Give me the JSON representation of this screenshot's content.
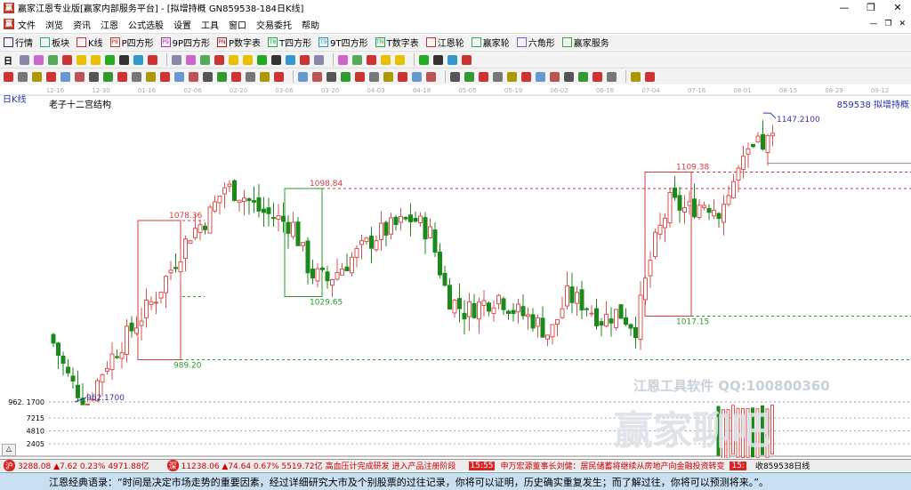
{
  "window": {
    "title": "赢家江恩专业版[赢家内部服务平台] - [拟增持概  GN859538-184日K线]",
    "min": "—",
    "max": "❐",
    "close": "✕"
  },
  "menu": [
    "文件",
    "浏览",
    "资讯",
    "江恩",
    "公式选股",
    "设置",
    "工具",
    "窗口",
    "交易委托",
    "帮助"
  ],
  "menu_right": [
    "—",
    "❐",
    "✕"
  ],
  "toolbar1": [
    {
      "icon": "grid-icon",
      "label": "行情"
    },
    {
      "icon": "blocks-icon",
      "label": "板块"
    },
    {
      "icon": "kline-icon",
      "label": "K线"
    },
    {
      "icon": "P8",
      "label": "P四方形"
    },
    {
      "icon": "P9",
      "label": "9P四方形"
    },
    {
      "icon": "PN",
      "label": "P数字表"
    },
    {
      "icon": "T8",
      "label": "T四方形"
    },
    {
      "icon": "T9",
      "label": "9T四方形"
    },
    {
      "icon": "TN",
      "label": "T数字表"
    },
    {
      "icon": "wheel-icon",
      "label": "江恩轮"
    },
    {
      "icon": "wheel2-icon",
      "label": "赢家轮"
    },
    {
      "icon": "hexagon-icon",
      "label": "六角形"
    },
    {
      "icon": "dollar-icon",
      "label": "赢家服务"
    }
  ],
  "toolbar2_label": "日",
  "period_label": "日K线",
  "indicator_title": "老子十二宫结构",
  "symbol_label": "859538  拟增持概",
  "colors": {
    "up": "#d9534f",
    "down": "#1a8a1a",
    "box_red": "#d43a3a",
    "box_green": "#2a9a2a",
    "blue": "#3333aa"
  },
  "chart_data": {
    "type": "candlestick",
    "x_ticks": [
      "12-16",
      "12-30",
      "01-16",
      "02-06",
      "02-20",
      "03-06",
      "03-20",
      "04-03",
      "04-18",
      "05-05",
      "05-19",
      "06-02",
      "06-16",
      "07-04",
      "07-18",
      "08-01",
      "08-15",
      "08-29",
      "09-12"
    ],
    "ylim": [
      930,
      1160
    ],
    "close_keyframes": [
      1000,
      975,
      962,
      985,
      1000,
      1015,
      1030,
      1050,
      1070,
      1080,
      1100,
      1095,
      1085,
      1080,
      1075,
      1045,
      1040,
      1050,
      1060,
      1070,
      1075,
      1080,
      1070,
      1030,
      1020,
      1025,
      1030,
      1020,
      1015,
      1005,
      1030,
      1025,
      1015,
      1020,
      1010,
      1060,
      1090,
      1085,
      1090,
      1085,
      1110,
      1125,
      1130
    ],
    "high_label": "1147.2100",
    "low_label": "962.1700",
    "axis_low_label": "962. 1700",
    "levels": [
      {
        "value": 1098.84,
        "label": "1098.84",
        "color": "red"
      },
      {
        "value": 1109.38,
        "label": "1109.38",
        "color": "red"
      },
      {
        "value": 1078.36,
        "label": "1078.36",
        "color": "red"
      },
      {
        "value": 1029.65,
        "label": "1029.65",
        "color": "green"
      },
      {
        "value": 1017.15,
        "label": "1017.15",
        "color": "green"
      },
      {
        "value": 989.2,
        "label": "989.20",
        "color": "green"
      }
    ],
    "volume_ticks": [
      "7215",
      "4810",
      "2405"
    ]
  },
  "watermark": {
    "text": "江恩工具软件  QQ:100800360",
    "logo": "赢家聊吧"
  },
  "status": {
    "sh": "3288.08 ▲7.62 0.23% 4971.88亿",
    "sz": "11238.06 ▲74.64 0.67% 5519.72亿",
    "news1": "高血压计完成研发 进入产品注册阶段",
    "time1": "15:55",
    "news2": "申万宏源董事长刘健：居民储蓄将继续从房地产向金融投资转变",
    "time2": "15:",
    "right": "收859538日线"
  },
  "quote": "江恩经典语录：“时间是决定市场走势的重要因素，经过详细研究大市及个别股票的过往记录，你将可以证明，历史确实重复发生；而了解过往，你将可以预测将来。”。"
}
